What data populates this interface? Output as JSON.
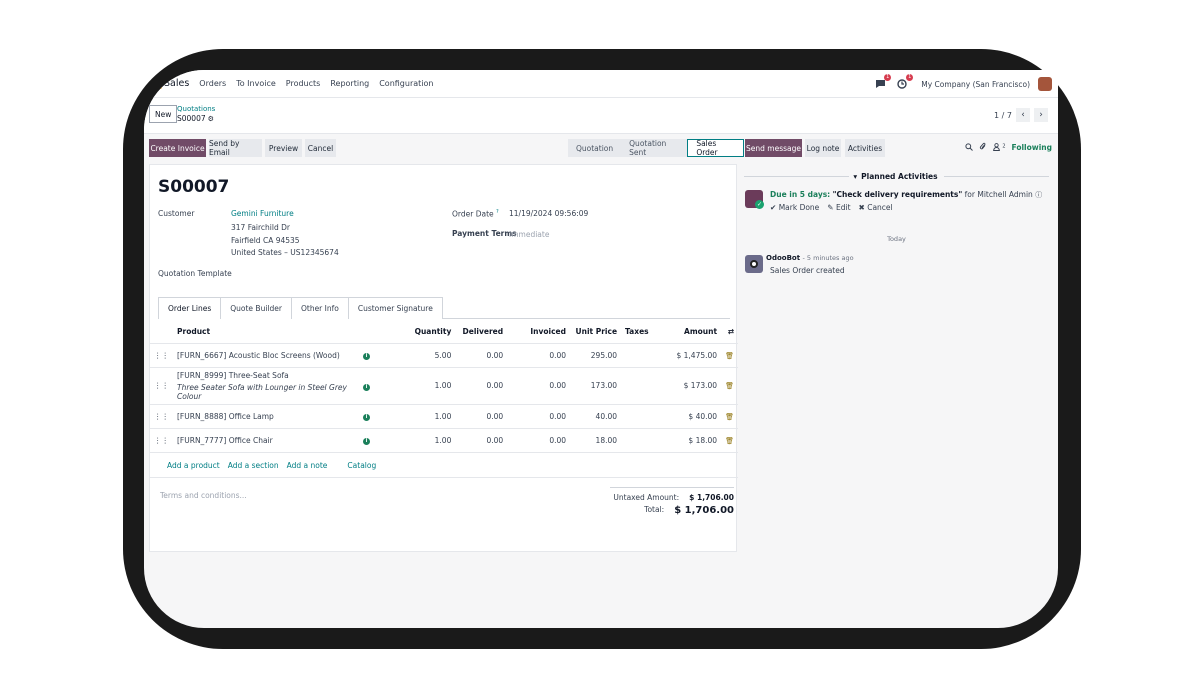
{
  "topnav": {
    "app_name": "Sales",
    "menu": [
      "Orders",
      "To Invoice",
      "Products",
      "Reporting",
      "Configuration"
    ],
    "messages_badge": "1",
    "activities_badge": "1",
    "company": "My Company (San Francisco)"
  },
  "control": {
    "new_label": "New",
    "breadcrumb_parent": "Quotations",
    "breadcrumb_current": "S00007",
    "pager": "1 / 7",
    "prev": "‹",
    "next": "›"
  },
  "actions": {
    "create_invoice": "Create Invoice",
    "send_by_email": "Send by Email",
    "preview": "Preview",
    "cancel": "Cancel"
  },
  "statusbar": [
    "Quotation",
    "Quotation Sent",
    "Sales Order"
  ],
  "form": {
    "name": "S00007",
    "customer_label": "Customer",
    "customer_name": "Gemini Furniture",
    "address_line1": "317 Fairchild Dr",
    "address_line2": "Fairfield CA 94535",
    "address_line3": "United States – US12345674",
    "quotation_template_label": "Quotation Template",
    "order_date_label": "Order Date",
    "order_date_help": "?",
    "order_date": "11/19/2024 09:56:09",
    "payment_terms_label": "Payment Terms",
    "payment_terms_placeholder": "Immediate"
  },
  "tabs": [
    "Order Lines",
    "Quote Builder",
    "Other Info",
    "Customer Signature"
  ],
  "lines": {
    "headers": {
      "product": "Product",
      "quantity": "Quantity",
      "delivered": "Delivered",
      "invoiced": "Invoiced",
      "unit_price": "Unit Price",
      "taxes": "Taxes",
      "amount": "Amount"
    },
    "rows": [
      {
        "product": "[FURN_6667] Acoustic Bloc Screens (Wood)",
        "description": "",
        "quantity": "5.00",
        "delivered": "0.00",
        "invoiced": "0.00",
        "unit_price": "295.00",
        "amount": "$ 1,475.00"
      },
      {
        "product": "[FURN_8999] Three-Seat Sofa",
        "description": "Three Seater Sofa with Lounger in Steel Grey Colour",
        "quantity": "1.00",
        "delivered": "0.00",
        "invoiced": "0.00",
        "unit_price": "173.00",
        "amount": "$ 173.00"
      },
      {
        "product": "[FURN_8888] Office Lamp",
        "description": "",
        "quantity": "1.00",
        "delivered": "0.00",
        "invoiced": "0.00",
        "unit_price": "40.00",
        "amount": "$ 40.00"
      },
      {
        "product": "[FURN_7777] Office Chair",
        "description": "",
        "quantity": "1.00",
        "delivered": "0.00",
        "invoiced": "0.00",
        "unit_price": "18.00",
        "amount": "$ 18.00"
      }
    ],
    "add_product": "Add a product",
    "add_section": "Add a section",
    "add_note": "Add a note",
    "catalog": "Catalog"
  },
  "footer": {
    "terms_placeholder": "Terms and conditions...",
    "untaxed_label": "Untaxed Amount:",
    "untaxed_value": "$ 1,706.00",
    "total_label": "Total:",
    "total_value": "$ 1,706.00"
  },
  "chatter": {
    "send_message": "Send message",
    "log_note": "Log note",
    "activities": "Activities",
    "followers_count": "2",
    "following": "Following",
    "planned_activities": "Planned Activities",
    "activity": {
      "due": "Due in 5 days:",
      "summary": "\"Check delivery requirements\"",
      "for": "for Mitchell Admin",
      "mark_done": "Mark Done",
      "edit": "Edit",
      "cancel": "Cancel"
    },
    "today": "Today",
    "message": {
      "author": "OdooBot",
      "time": "- 5 minutes ago",
      "body": "Sales Order created"
    }
  },
  "colors": {
    "primary": "#714b67",
    "link": "#017e84",
    "success": "#1a7f5a",
    "badge": "#d63c4f"
  }
}
